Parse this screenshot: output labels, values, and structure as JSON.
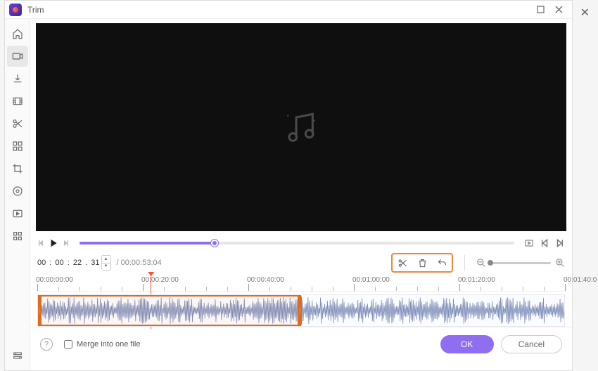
{
  "window": {
    "title": "Trim"
  },
  "controls": {},
  "time": {
    "current_h": "00",
    "current_m": "00",
    "current_s": "22",
    "current_f": "31",
    "total": "/ 00:00:53:04"
  },
  "ruler": {
    "labels": [
      "00:00:00:00",
      "00:00:20:00",
      "00:00:40:00",
      "00:01:00:00",
      "00:01:20:00",
      "00:01:40:0"
    ]
  },
  "footer": {
    "merge_label": "Merge into one file",
    "ok_label": "OK",
    "cancel_label": "Cancel"
  },
  "selection": {
    "start_percent": 0,
    "end_percent": 50
  },
  "playhead_percent": 21.5
}
